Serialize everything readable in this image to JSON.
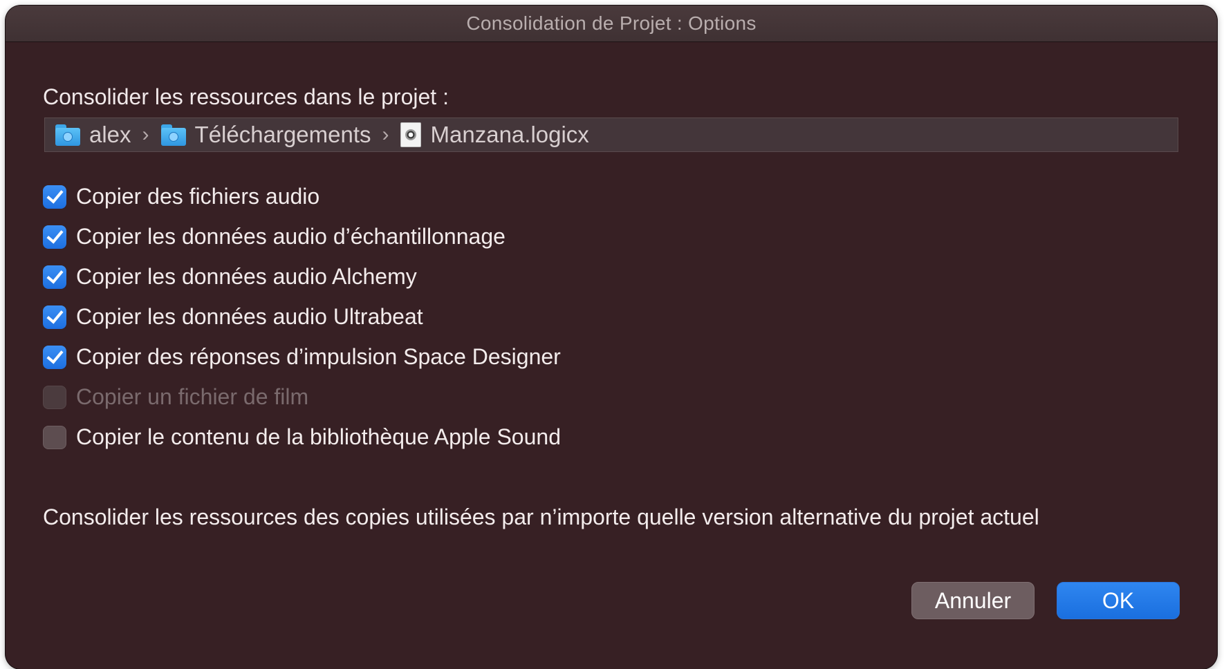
{
  "window": {
    "title": "Consolidation de Projet : Options"
  },
  "destination": {
    "label": "Consolider les ressources dans le projet :",
    "path": [
      {
        "icon": "home-folder-icon",
        "label": "alex"
      },
      {
        "icon": "downloads-folder-icon",
        "label": "Téléchargements"
      },
      {
        "icon": "logic-project-file-icon",
        "label": "Manzana.logicx"
      }
    ],
    "separator": "›"
  },
  "options": [
    {
      "label": "Copier des fichiers audio",
      "checked": true,
      "enabled": true
    },
    {
      "label": "Copier les données audio d’échantillonnage",
      "checked": true,
      "enabled": true
    },
    {
      "label": "Copier les données audio Alchemy",
      "checked": true,
      "enabled": true
    },
    {
      "label": "Copier les données audio Ultrabeat",
      "checked": true,
      "enabled": true
    },
    {
      "label": "Copier des réponses d’impulsion Space Designer",
      "checked": true,
      "enabled": true
    },
    {
      "label": "Copier un fichier de film",
      "checked": false,
      "enabled": false
    },
    {
      "label": "Copier le contenu de la bibliothèque Apple Sound",
      "checked": false,
      "enabled": true
    }
  ],
  "footer_note": "Consolider les ressources des copies utilisées par n’importe quelle version alternative du projet actuel",
  "buttons": {
    "cancel": "Annuler",
    "ok": "OK"
  },
  "colors": {
    "window_bg": "#372024",
    "accent": "#1d6fe0",
    "text": "#f3ecec"
  }
}
